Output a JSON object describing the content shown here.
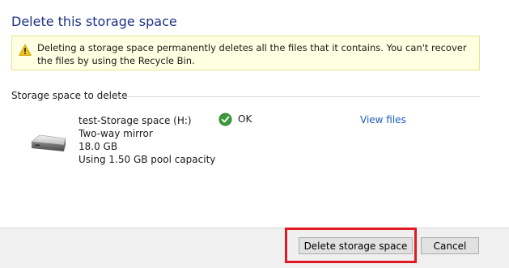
{
  "page": {
    "title": "Delete this storage space"
  },
  "warning": {
    "icon": "warning-icon",
    "text": "Deleting a storage space permanently deletes all the files that it contains. You can't recover the files by using the Recycle Bin."
  },
  "section": {
    "label": "Storage space to delete"
  },
  "drive": {
    "icon": "drive-icon",
    "name": "test-Storage space (H:)",
    "resiliency": "Two-way mirror",
    "size": "18.0 GB",
    "usage": "Using 1.50 GB pool capacity",
    "status_icon": "check-icon",
    "status": "OK",
    "view_files_label": "View files"
  },
  "footer": {
    "delete_label": "Delete storage space",
    "cancel_label": "Cancel"
  },
  "colors": {
    "title": "#1e3287",
    "link": "#1a5bc4",
    "warning_bg": "#ffffe1",
    "ok_green": "#3a9a3a",
    "highlight": "#e01b24"
  }
}
